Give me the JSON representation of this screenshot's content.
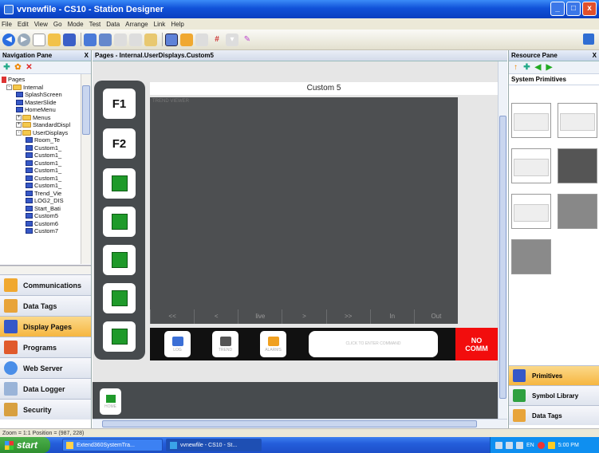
{
  "window": {
    "title": "vvnewfile - CS10 - Station Designer",
    "buttons": {
      "minimize": "_",
      "maximize": "□",
      "close": "x"
    }
  },
  "menu": [
    "File",
    "Edit",
    "View",
    "Go",
    "Mode",
    "Test",
    "Data",
    "Arrange",
    "Link",
    "Help"
  ],
  "navigation_pane": {
    "title": "Navigation Pane",
    "close": "X",
    "tree": [
      {
        "label": "Pages",
        "level": 0,
        "type": "root"
      },
      {
        "label": "Internal",
        "level": 1,
        "type": "folder",
        "expander": "-"
      },
      {
        "label": "SplashScreen",
        "level": 2,
        "type": "page"
      },
      {
        "label": "MasterSlide",
        "level": 2,
        "type": "page"
      },
      {
        "label": "HomeMenu",
        "level": 2,
        "type": "page"
      },
      {
        "label": "Menus",
        "level": 2,
        "type": "folder",
        "expander": "+"
      },
      {
        "label": "StandardDispl",
        "level": 2,
        "type": "folder",
        "expander": "+"
      },
      {
        "label": "UserDisplays",
        "level": 2,
        "type": "folder",
        "expander": "-"
      },
      {
        "label": "Room_Te",
        "level": 3,
        "type": "page"
      },
      {
        "label": "Custom1_",
        "level": 3,
        "type": "page"
      },
      {
        "label": "Custom1_",
        "level": 3,
        "type": "page"
      },
      {
        "label": "Custom1_",
        "level": 3,
        "type": "page"
      },
      {
        "label": "Custom1_",
        "level": 3,
        "type": "page"
      },
      {
        "label": "Custom1_",
        "level": 3,
        "type": "page"
      },
      {
        "label": "Custom1_",
        "level": 3,
        "type": "page"
      },
      {
        "label": "Trend_Vie",
        "level": 3,
        "type": "page"
      },
      {
        "label": "LOG2_DIS",
        "level": 3,
        "type": "page"
      },
      {
        "label": "Start_Bati",
        "level": 3,
        "type": "page"
      },
      {
        "label": "Custom5",
        "level": 3,
        "type": "page"
      },
      {
        "label": "Custom6",
        "level": 3,
        "type": "page"
      },
      {
        "label": "Custom7",
        "level": 3,
        "type": "page"
      }
    ],
    "buttons": [
      "Communications",
      "Data Tags",
      "Display Pages",
      "Programs",
      "Web Server",
      "Data Logger",
      "Security"
    ],
    "active_button": "Display Pages"
  },
  "document": {
    "tab_title": "Pages - Internal.UserDisplays.Custom5",
    "page_title": "Custom 5",
    "screen_tag": "TREND VIEWER",
    "function_keys": [
      "F1",
      "F2"
    ],
    "trend_controls": [
      "<<",
      "<",
      "live",
      ">",
      ">>",
      "In",
      "Out"
    ],
    "bottom_buttons": [
      {
        "label": "LOG",
        "color": "#3b6fd6"
      },
      {
        "label": "TREND",
        "color": "#555555"
      },
      {
        "label": "ALARMS",
        "color": "#f0a020"
      }
    ],
    "command_box": "CLICK TO ENTER COMMAND",
    "status": {
      "line1": "NO",
      "line2": "COMM"
    },
    "home_button": "HOME"
  },
  "resource_pane": {
    "title": "Resource Pane",
    "close": "X",
    "section": "System Primitives",
    "buttons": [
      "Primitives",
      "Symbol Library",
      "Data Tags"
    ],
    "active_button": "Primitives"
  },
  "status_bar": "Zoom = 1:1  Position = (987, 228)",
  "taskbar": {
    "start": "start",
    "tasks": [
      "Extend360SystemTra...",
      "vvnewfile - CS10 - St..."
    ],
    "tray_language": "EN",
    "clock": "5:00 PM"
  },
  "colors": {
    "titlebar": "#1151d8",
    "active_nav": "#f6b640",
    "function_green": "#1f9a2a",
    "nocomm_red": "#f20d0d"
  }
}
